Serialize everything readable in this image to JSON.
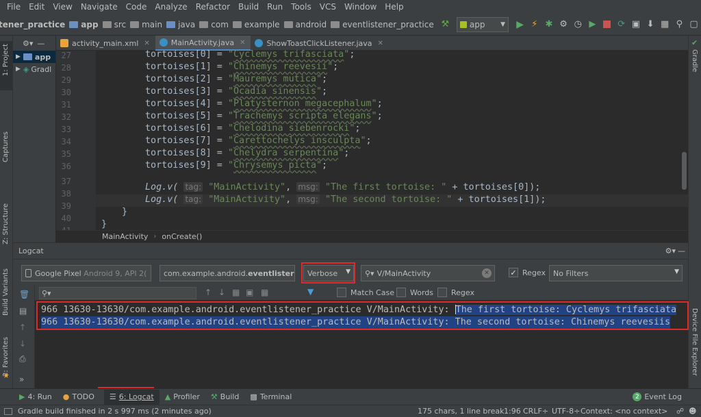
{
  "menu": [
    "File",
    "Edit",
    "View",
    "Navigate",
    "Code",
    "Analyze",
    "Refactor",
    "Build",
    "Run",
    "Tools",
    "VCS",
    "Window",
    "Help"
  ],
  "breadcrumbs": [
    "tener_practice",
    "app",
    "src",
    "main",
    "java",
    "com",
    "example",
    "android",
    "eventlistener_practice"
  ],
  "run_config": "app",
  "left_tools": {
    "project": "1: Project",
    "captures": "Captures",
    "structure": "Z: Structure",
    "build_variants": "Build Variants",
    "favorites": "2: Favorites"
  },
  "right_tools": {
    "gradle": "Gradle",
    "device_explorer": "Device File Explorer"
  },
  "project_tree": [
    {
      "label": "app"
    },
    {
      "label": "Gradl"
    }
  ],
  "tabs": [
    {
      "label": "activity_main.xml",
      "icon": "xml-file-icon",
      "color": "#e8a33d"
    },
    {
      "label": "MainActivity.java",
      "icon": "class-icon",
      "color": "#3a8fc4"
    },
    {
      "label": "ShowToastClickListener.java",
      "icon": "class-icon",
      "color": "#3a8fc4"
    }
  ],
  "code": {
    "lines": [
      {
        "n": "27",
        "idx": "0",
        "name": "Cyclemys trifasciata"
      },
      {
        "n": "28",
        "idx": "1",
        "name": "Chinemys reevesii"
      },
      {
        "n": "29",
        "idx": "2",
        "name": "Mauremys mutica"
      },
      {
        "n": "30",
        "idx": "3",
        "name": "Ocadia sinensis"
      },
      {
        "n": "31",
        "idx": "4",
        "name": "Platysternon megacephalum"
      },
      {
        "n": "32",
        "idx": "5",
        "name": "Trachemys scripta elegans"
      },
      {
        "n": "33",
        "idx": "6",
        "name": "Chelodina siebenrocki"
      },
      {
        "n": "34",
        "idx": "7",
        "name": "Carettochelys insculpta"
      },
      {
        "n": "35",
        "idx": "8",
        "name": "Chelydra serpentina"
      },
      {
        "n": "36",
        "idx": "9",
        "name": "Chrysemys picta"
      }
    ],
    "ln37": "37",
    "ln38": "38",
    "ln39": "39",
    "ln40": "40",
    "ln41": "41",
    "var": "tortoises",
    "log_call": "Log.v(",
    "tag_hint": "tag:",
    "msg_hint": "msg:",
    "tag_value": "\"MainActivity\"",
    "msg1": "\"The first tortoise: \"",
    "msg2": "\"The second tortoise: \"",
    "rest1": " + tortoises[0]);",
    "rest2": " + tortoises[1]);",
    "brace_close": "}",
    "class_close": "}"
  },
  "editor_breadcrumb": {
    "cls": "MainActivity",
    "method": "onCreate()"
  },
  "logcat": {
    "title": "Logcat",
    "device": "Google Pixel",
    "device_detail": "Android 9, API 2(",
    "package_prefix": "com.example.android.",
    "package_bold": "eventlister",
    "level": "Verbose",
    "search": "V/MainActivity",
    "regex_label": "Regex",
    "regex_checked": true,
    "filter": "No Filters",
    "match_case": "Match Case",
    "words": "Words",
    "regex2": "Regex",
    "lines": [
      {
        "prefix": "966 13630-13630/com.example.android.eventlistener_practice V/MainActivity: ",
        "message": "The first tortoise: Cyclemys trifasciata"
      },
      {
        "prefix": "966 13630-13630/com.example.android.eventlistener_practice V/MainActivity: ",
        "message": "The second tortoise: Chinemys reevesiis"
      }
    ]
  },
  "bottom_tools": [
    {
      "label": "4: Run",
      "icon": "run-icon"
    },
    {
      "label": "TODO",
      "icon": "todo-icon"
    },
    {
      "label": "6: Logcat",
      "icon": "logcat-icon"
    },
    {
      "label": "Profiler",
      "icon": "profiler-icon"
    },
    {
      "label": "Build",
      "icon": "build-icon"
    },
    {
      "label": "Terminal",
      "icon": "terminal-icon"
    }
  ],
  "event_log": "Event Log",
  "event_count": "2",
  "status": {
    "message": "Gradle build finished in 2 s 997 ms (2 minutes ago)",
    "chars": "175 chars, 1 line break",
    "position": "1:96",
    "line_sep": "CRLF÷",
    "encoding": "UTF-8÷",
    "context": "Context: <no context>"
  }
}
